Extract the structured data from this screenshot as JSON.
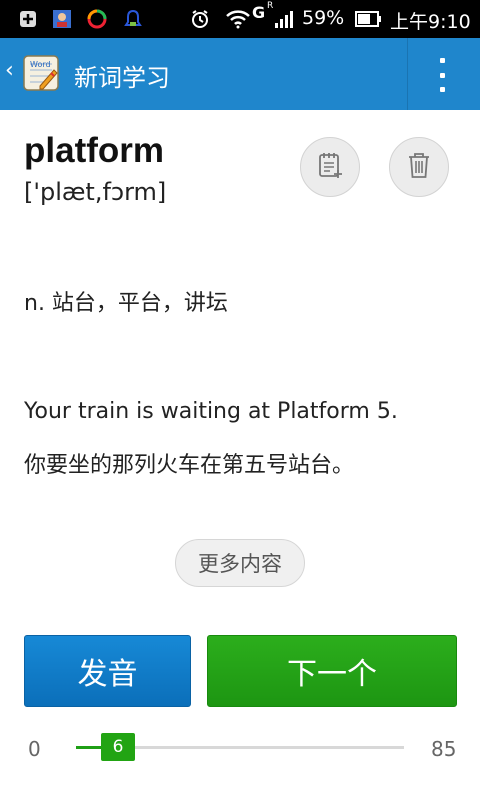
{
  "status_bar": {
    "battery_percent": "59%",
    "time": "上午9:10",
    "signal_label": "G",
    "roaming_label": "R"
  },
  "app_bar": {
    "back_glyph": "‹",
    "title": "新词学习"
  },
  "word": {
    "headword": "platform",
    "phonetic": "['plæt,fɔrm]",
    "definition": "n. 站台，平台，讲坛",
    "example_en": "Your train is waiting at Platform 5.",
    "example_zh": "你要坐的那列火车在第五号站台。"
  },
  "more_button": "更多内容",
  "buttons": {
    "pronounce": "发音",
    "next": "下一个"
  },
  "progress": {
    "min": "0",
    "max": "85",
    "current": "6",
    "current_value": 6,
    "max_value": 85
  },
  "colors": {
    "app_bar": "#1f86cc",
    "pronounce_button": "#0f7ac6",
    "next_button": "#22a413",
    "slider_thumb": "#22a413"
  },
  "icons": {
    "add_note": "add-note-icon",
    "delete": "trash-icon",
    "menu": "overflow-menu-icon",
    "app_logo": "word-notepad-logo-icon"
  }
}
